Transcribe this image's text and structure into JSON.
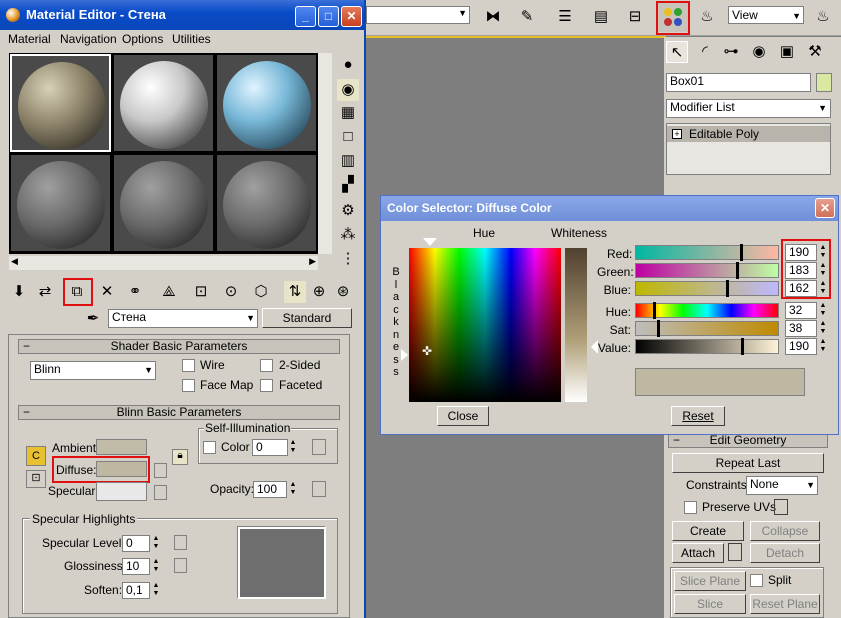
{
  "material_editor": {
    "title": "Material Editor - Стена",
    "menu": [
      "Material",
      "Navigation",
      "Options",
      "Utilities"
    ],
    "material_name": "Стена",
    "material_type": "Standard",
    "shader_rollout": "Shader Basic Parameters",
    "shader": "Blinn",
    "checks": {
      "wire": "Wire",
      "two_sided": "2-Sided",
      "face_map": "Face Map",
      "faceted": "Faceted"
    },
    "blinn_rollout": "Blinn Basic Parameters",
    "self_illum": "Self-Illumination",
    "color_label": "Color",
    "color_value": "0",
    "ambient": "Ambient:",
    "diffuse": "Diffuse:",
    "specular": "Specular:",
    "opacity_label": "Opacity:",
    "opacity_value": "100",
    "spec_group": "Specular Highlights",
    "spec_level_label": "Specular Level:",
    "spec_level": "0",
    "glossiness_label": "Glossiness:",
    "glossiness": "10",
    "soften_label": "Soften:",
    "soften": "0,1",
    "colors": {
      "ambient": "#c0bca8",
      "diffuse": "#beb7a2",
      "specular": "#e8e8e8",
      "preview": "#6e6e6e"
    }
  },
  "toolbar": {
    "view_label": "View"
  },
  "command_panel": {
    "object_name": "Box01",
    "modifier_list": "Modifier List",
    "stack_item": "Editable Poly",
    "edit_geometry": "Edit Geometry",
    "repeat_last": "Repeat Last",
    "constraints_label": "Constraints:",
    "constraints_value": "None",
    "preserve_uvs": "Preserve UVs",
    "create": "Create",
    "collapse": "Collapse",
    "attach": "Attach",
    "detach": "Detach",
    "slice_plane": "Slice Plane",
    "split": "Split",
    "slice": "Slice",
    "reset_plane": "Reset Plane"
  },
  "color_selector": {
    "title": "Color Selector: Diffuse Color",
    "hue_label": "Hue",
    "whiteness_label": "Whiteness",
    "blackness_letters": [
      "B",
      "l",
      "a",
      "c",
      "k",
      "n",
      "e",
      "s",
      "s"
    ],
    "red_label": "Red:",
    "green_label": "Green:",
    "blue_label": "Blue:",
    "hue_field_label": "Hue:",
    "sat_label": "Sat:",
    "value_label": "Value:",
    "red": "190",
    "green": "183",
    "blue": "162",
    "hue": "32",
    "sat": "38",
    "value": "190",
    "close": "Close",
    "reset": "Reset",
    "swatch_color": "#beb7a2"
  }
}
